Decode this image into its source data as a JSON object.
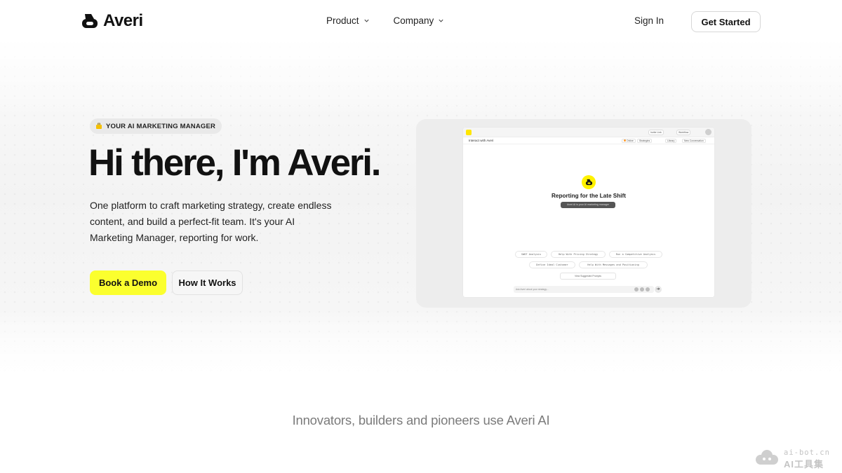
{
  "nav": {
    "brand": "Averi",
    "links": [
      {
        "label": "Product"
      },
      {
        "label": "Company"
      }
    ],
    "sign_in": "Sign In",
    "get_started": "Get Started"
  },
  "hero": {
    "badge": "YOUR AI MARKETING MANAGER",
    "title": "Hi there, I'm Averi.",
    "subtitle": "One platform to craft marketing strategy, create endless content, and build a perfect-fit team. It's your AI Marketing Manager, reporting for work.",
    "primary_cta": "Book a Demo",
    "secondary_cta": "How It Works"
  },
  "preview": {
    "top_chips": [
      "Invite Link",
      "Workflow"
    ],
    "bar_title": "Interact with Averi",
    "bar_chips": [
      "Strategies",
      "Library",
      "New Conversation"
    ],
    "bar_status": "Online",
    "heading": "Reporting for the Late Shift",
    "tag": "Averi AI is your AI marketing manager",
    "pills_row1": [
      "SWOT Analysis",
      "Help With Pricing Strategy",
      "Run a Competitive Analysis"
    ],
    "pills_row2": [
      "Define Ideal Customer",
      "Help With Messages and Positioning"
    ],
    "suggest": "View Suggested Prompts",
    "input_placeholder": "Ask Averi about your strategy..."
  },
  "tagline": "Innovators, builders and pioneers use Averi AI",
  "watermark": {
    "url": "ai-bot.cn",
    "label": "AI工具集"
  },
  "colors": {
    "accent": "#fbff2e",
    "text": "#111111",
    "muted": "#7b7b7b"
  }
}
